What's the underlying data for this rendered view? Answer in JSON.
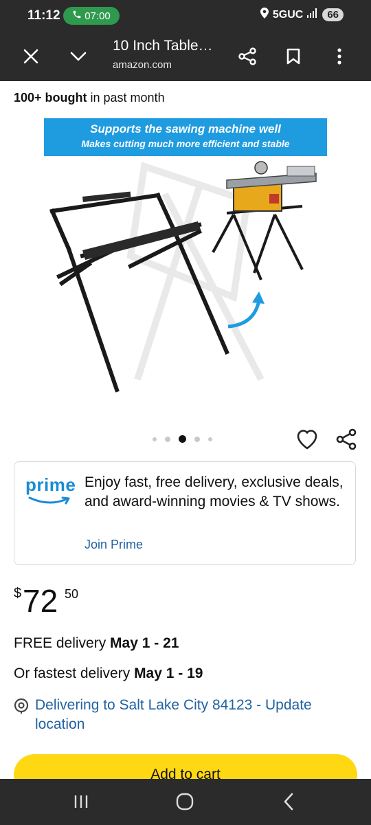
{
  "status_bar": {
    "time": "11:12",
    "call_timer": "07:00",
    "network": "5GUC",
    "battery": "66"
  },
  "browser": {
    "title": "10 Inch Table…",
    "domain": "amazon.com"
  },
  "product": {
    "bought_strong": "100+ bought",
    "bought_rest": " in past month",
    "banner_line1": "Supports the sawing machine well",
    "banner_line2": "Makes cutting much more efficient and stable",
    "image_count": 5,
    "active_image": 3
  },
  "prime": {
    "logo": "prime",
    "text": "Enjoy fast, free delivery, exclusive deals, and award-winning movies & TV shows.",
    "link": "Join Prime"
  },
  "price": {
    "symbol": "$",
    "whole": "72",
    "fraction": "50"
  },
  "delivery": {
    "free_label": "FREE delivery ",
    "free_dates": "May 1 - 21",
    "fast_label": "Or fastest delivery ",
    "fast_dates": "May 1 - 19",
    "location": "Delivering to Salt Lake City 84123 - Update location"
  },
  "cart_button": "Add to cart",
  "colors": {
    "prime_blue": "#1a8bd6",
    "link": "#2162a1",
    "cart": "#ffd814",
    "banner": "#1f9be0"
  }
}
